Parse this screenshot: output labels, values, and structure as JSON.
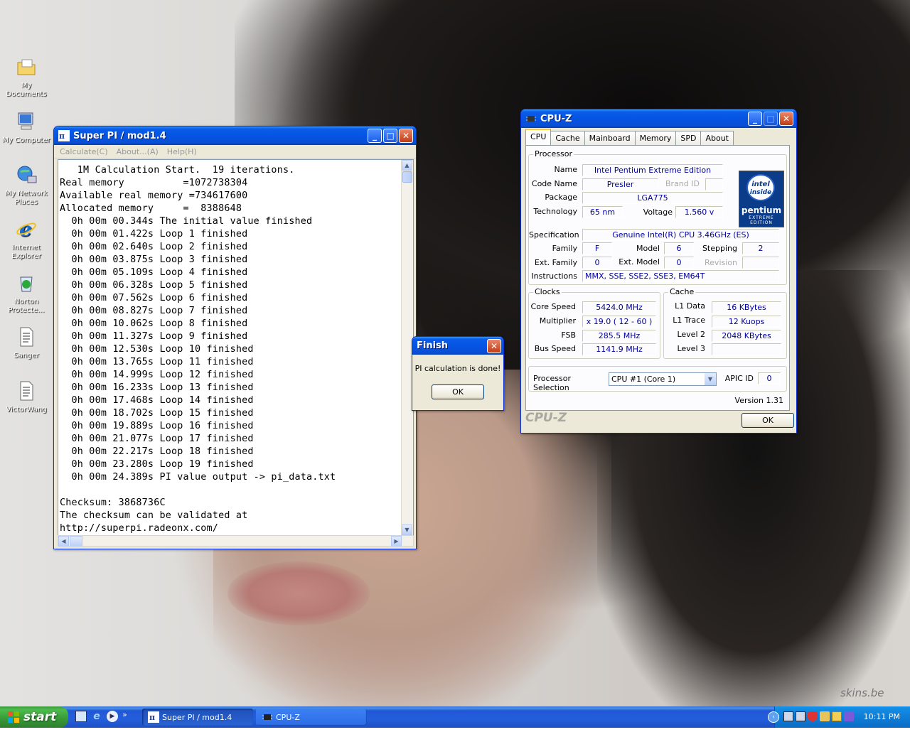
{
  "desktop": {
    "icons": [
      {
        "label": "My Documents",
        "icon": "folder-documents-icon"
      },
      {
        "label": "My Computer",
        "icon": "computer-icon"
      },
      {
        "label": "My Network Places",
        "icon": "network-places-icon"
      },
      {
        "label": "Internet Explorer",
        "icon": "internet-explorer-icon"
      },
      {
        "label": "Norton Protecte...",
        "icon": "norton-recycle-icon"
      },
      {
        "label": "Sanger",
        "icon": "text-document-icon"
      },
      {
        "label": "VictorWang",
        "icon": "text-document-icon"
      }
    ],
    "watermark": "skins.be"
  },
  "superpi": {
    "title": "Super PI / mod1.4",
    "menu": [
      "Calculate(C)",
      "About...(A)",
      "Help(H)"
    ],
    "lines": [
      "   1M Calculation Start.  19 iterations.",
      "Real memory          =1072738304",
      "Available real memory =734617600",
      "Allocated memory     =  8388648",
      "  0h 00m 00.344s The initial value finished",
      "  0h 00m 01.422s Loop 1 finished",
      "  0h 00m 02.640s Loop 2 finished",
      "  0h 00m 03.875s Loop 3 finished",
      "  0h 00m 05.109s Loop 4 finished",
      "  0h 00m 06.328s Loop 5 finished",
      "  0h 00m 07.562s Loop 6 finished",
      "  0h 00m 08.827s Loop 7 finished",
      "  0h 00m 10.062s Loop 8 finished",
      "  0h 00m 11.327s Loop 9 finished",
      "  0h 00m 12.530s Loop 10 finished",
      "  0h 00m 13.765s Loop 11 finished",
      "  0h 00m 14.999s Loop 12 finished",
      "  0h 00m 16.233s Loop 13 finished",
      "  0h 00m 17.468s Loop 14 finished",
      "  0h 00m 18.702s Loop 15 finished",
      "  0h 00m 19.889s Loop 16 finished",
      "  0h 00m 21.077s Loop 17 finished",
      "  0h 00m 22.217s Loop 18 finished",
      "  0h 00m 23.280s Loop 19 finished",
      "  0h 00m 24.389s PI value output -> pi_data.txt",
      "",
      "Checksum: 3868736C",
      "The checksum can be validated at",
      "http://superpi.radeonx.com/"
    ]
  },
  "finish_dialog": {
    "title": "Finish",
    "message": "PI calculation is done!",
    "ok_label": "OK"
  },
  "cpuz": {
    "title": "CPU-Z",
    "tabs": [
      "CPU",
      "Cache",
      "Mainboard",
      "Memory",
      "SPD",
      "About"
    ],
    "processor": {
      "group_label": "Processor",
      "name_label": "Name",
      "name": "Intel Pentium Extreme Edition",
      "codename_label": "Code Name",
      "codename": "Presler",
      "brandid_label": "Brand ID",
      "package_label": "Package",
      "package": "LGA775",
      "technology_label": "Technology",
      "technology": "65 nm",
      "voltage_label": "Voltage",
      "voltage": "1.560 v",
      "spec_label": "Specification",
      "spec": "Genuine Intel(R) CPU 3.46GHz (ES)",
      "family_label": "Family",
      "family": "F",
      "model_label": "Model",
      "model": "6",
      "stepping_label": "Stepping",
      "stepping": "2",
      "extfamily_label": "Ext. Family",
      "extfamily": "0",
      "extmodel_label": "Ext. Model",
      "extmodel": "0",
      "revision_label": "Revision",
      "instructions_label": "Instructions",
      "instructions": "MMX, SSE, SSE2, SSE3, EM64T",
      "logo_line1": "intel",
      "logo_line2": "inside",
      "logo_line3": "pentium",
      "logo_line4": "EXTREME",
      "logo_line5": "EDITION"
    },
    "clocks": {
      "group_label": "Clocks",
      "core_speed_label": "Core Speed",
      "core_speed": "5424.0 MHz",
      "multiplier_label": "Multiplier",
      "multiplier": "x 19.0  ( 12 - 60 )",
      "fsb_label": "FSB",
      "fsb": "285.5 MHz",
      "bus_speed_label": "Bus Speed",
      "bus_speed": "1141.9 MHz"
    },
    "cache": {
      "group_label": "Cache",
      "l1data_label": "L1 Data",
      "l1data": "16 KBytes",
      "l1trace_label": "L1 Trace",
      "l1trace": "12 Kuops",
      "level2_label": "Level 2",
      "level2": "2048 KBytes",
      "level3_label": "Level 3"
    },
    "processor_selection_label": "Processor Selection",
    "processor_selection": "CPU #1 (Core 1)",
    "apic_label": "APIC ID",
    "apic": "0",
    "version": "Version 1.31",
    "footer_brand": "CPU-Z",
    "ok_label": "OK"
  },
  "taskbar": {
    "start_label": "start",
    "items": [
      "Super PI / mod1.4",
      "CPU-Z"
    ],
    "clock": "10:11 PM"
  }
}
